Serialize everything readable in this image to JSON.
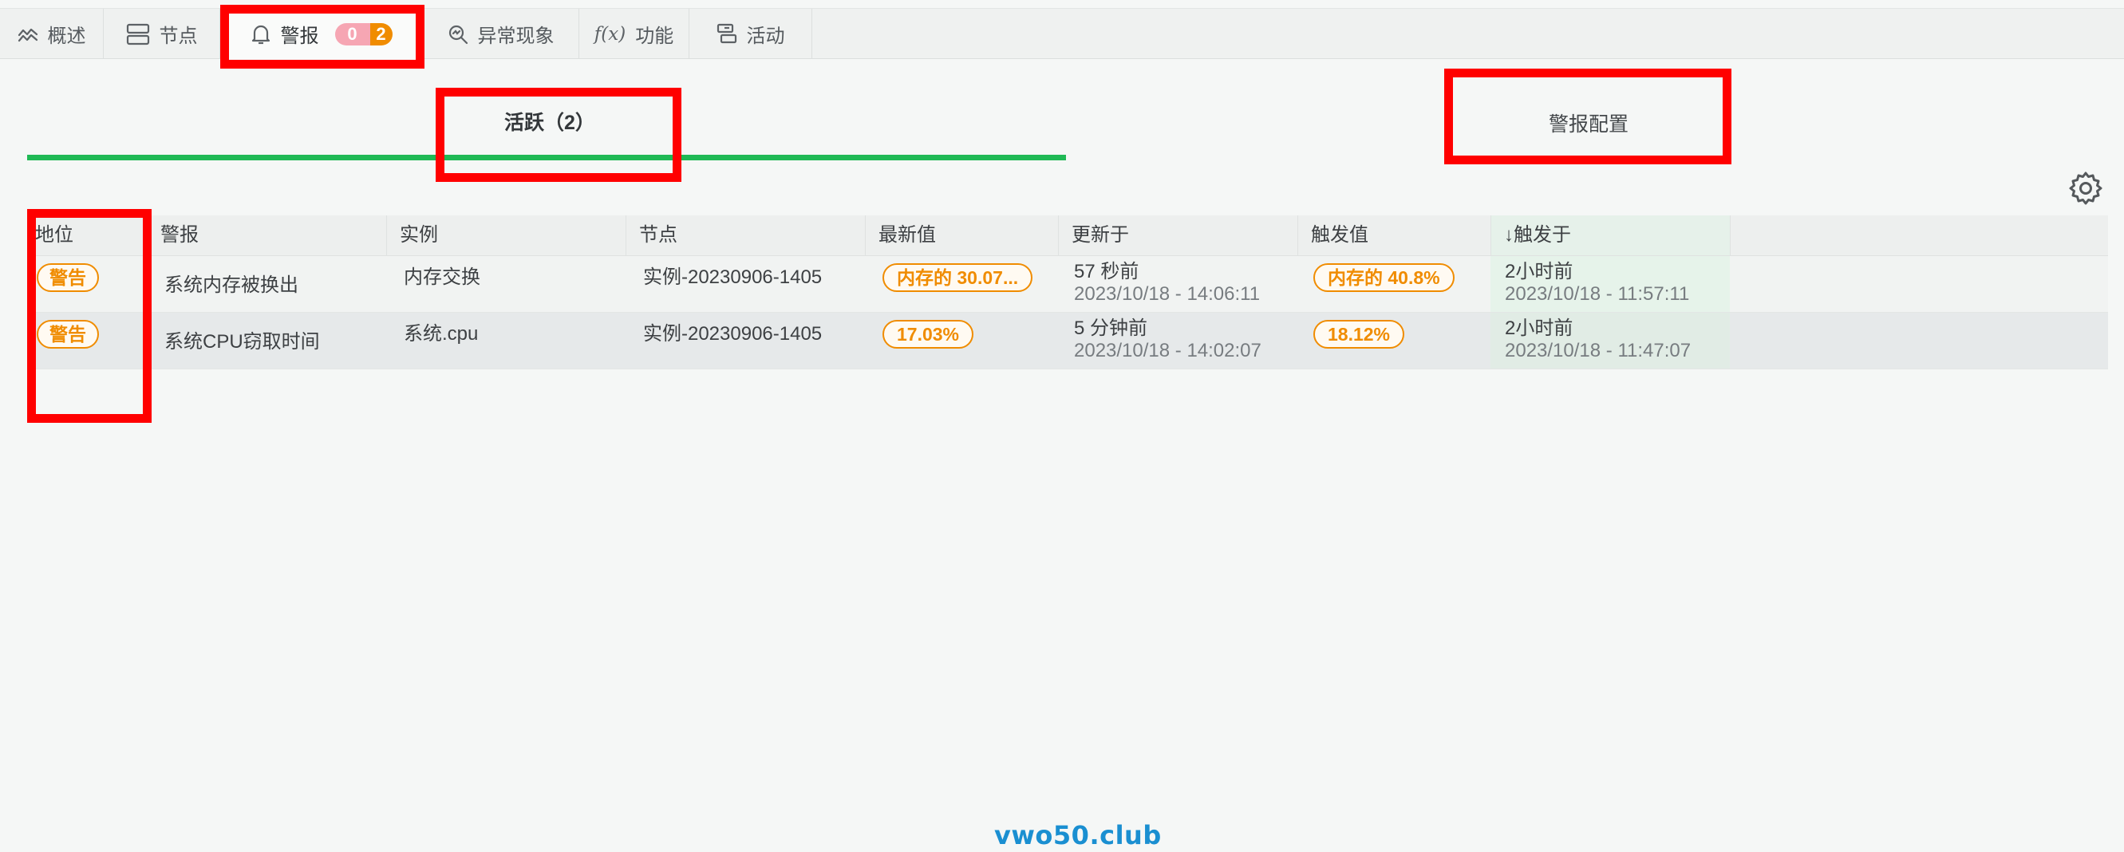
{
  "tabs": [
    {
      "label": "概述",
      "icon": "chart-line-icon"
    },
    {
      "label": "节点",
      "icon": "server-icon"
    },
    {
      "label": "警报",
      "icon": "bell-icon",
      "critical_count": "0",
      "warning_count": "2"
    },
    {
      "label": "异常现象",
      "icon": "magnifier-icon"
    },
    {
      "label": "功能",
      "icon": "function-icon",
      "icon_text": "f(x)"
    },
    {
      "label": "活动",
      "icon": "activity-log-icon"
    }
  ],
  "subtabs": {
    "active": "活跃（2）",
    "config": "警报配置"
  },
  "table": {
    "columns": [
      "地位",
      "警报",
      "实例",
      "节点",
      "最新值",
      "更新于",
      "触发值",
      "↓触发于"
    ],
    "rows": [
      {
        "status": "警告",
        "alert": "系统内存被换出",
        "instance": "内存交换",
        "node": "实例-20230906-1405",
        "latest_value": "内存的 30.07...",
        "updated_rel": "57 秒前",
        "updated_abs": "2023/10/18 - 14:06:11",
        "trigger_value": "内存的 40.8%",
        "triggered_rel": "2小时前",
        "triggered_abs": "2023/10/18 - 11:57:11"
      },
      {
        "status": "警告",
        "alert": "系统CPU窃取时间",
        "instance": "系统.cpu",
        "node": "实例-20230906-1405",
        "latest_value": "17.03%",
        "updated_rel": "5 分钟前",
        "updated_abs": "2023/10/18 - 14:02:07",
        "trigger_value": "18.12%",
        "triggered_rel": "2小时前",
        "triggered_abs": "2023/10/18 - 11:47:07"
      }
    ]
  },
  "watermark": "vwo50.club",
  "colors": {
    "accent_green": "#1fb955",
    "warning_orange": "#f08c00",
    "critical_pink": "#f6a6b3",
    "highlight_red": "#ff0000",
    "watermark_blue": "#1a8fd1"
  }
}
